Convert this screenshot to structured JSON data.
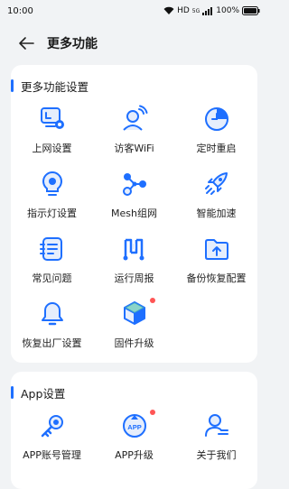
{
  "status_bar": {
    "time": "10:00",
    "network": "HD",
    "signal": "5G",
    "battery": "100%"
  },
  "header": {
    "title": "更多功能"
  },
  "section1": {
    "title": "更多功能设置",
    "items": [
      {
        "label": "上网设置",
        "icon": "internet-settings-icon"
      },
      {
        "label": "访客WiFi",
        "icon": "guest-wifi-icon"
      },
      {
        "label": "定时重启",
        "icon": "timed-restart-icon"
      },
      {
        "label": "指示灯设置",
        "icon": "indicator-light-icon"
      },
      {
        "label": "Mesh组网",
        "icon": "mesh-network-icon"
      },
      {
        "label": "智能加速",
        "icon": "smart-boost-icon"
      },
      {
        "label": "常见问题",
        "icon": "faq-icon"
      },
      {
        "label": "运行周报",
        "icon": "weekly-report-icon"
      },
      {
        "label": "备份恢复配置",
        "icon": "backup-restore-icon"
      },
      {
        "label": "恢复出厂设置",
        "icon": "factory-reset-icon"
      },
      {
        "label": "固件升级",
        "icon": "firmware-upgrade-icon"
      }
    ]
  },
  "section2": {
    "title": "App设置",
    "items": [
      {
        "label": "APP账号管理",
        "icon": "account-management-icon"
      },
      {
        "label": "APP升级",
        "icon": "app-upgrade-icon",
        "badge_text": "APP"
      },
      {
        "label": "关于我们",
        "icon": "about-us-icon"
      }
    ]
  },
  "colors": {
    "accent": "#1e6fff",
    "accent_light": "#e6eefc",
    "badge": "#ff5555",
    "background": "#f1f3f5"
  }
}
